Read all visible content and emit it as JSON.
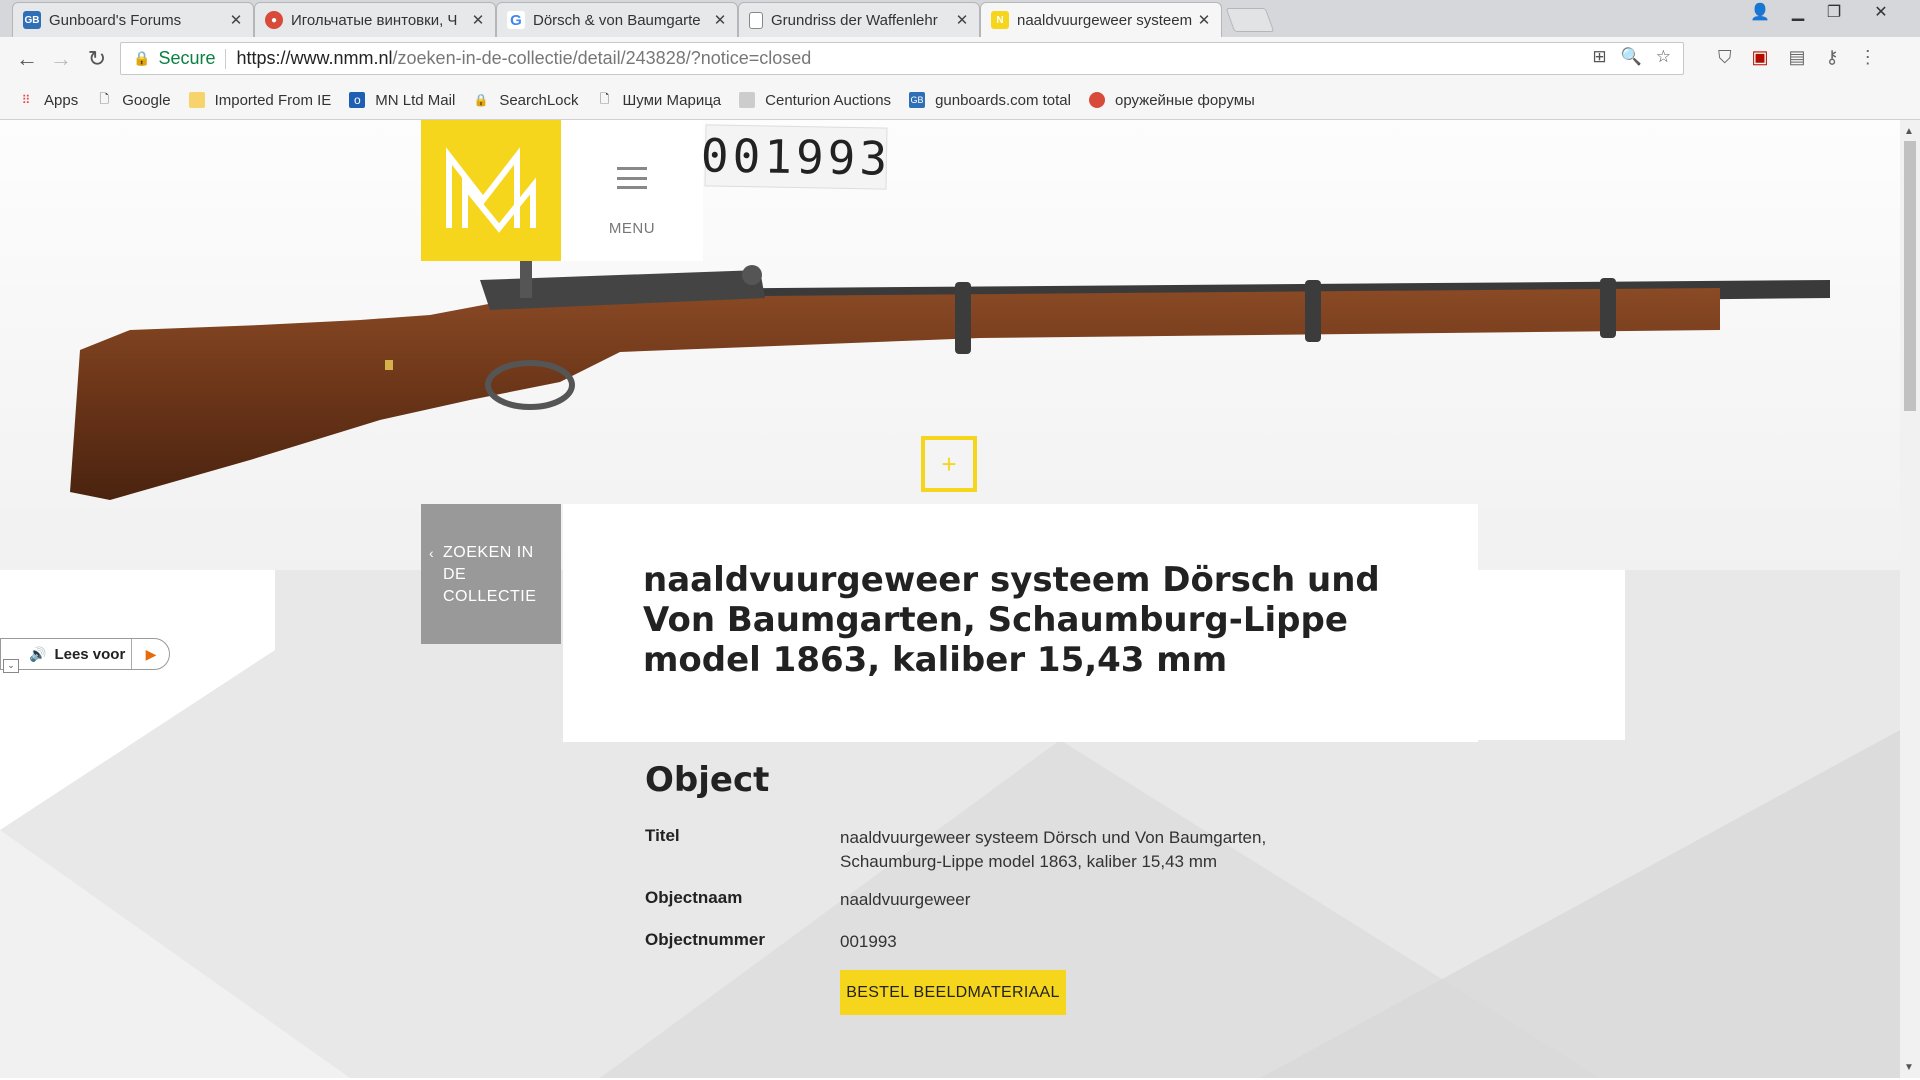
{
  "browser": {
    "tabs": [
      {
        "title": "Gunboard's Forums",
        "favicon": "GB",
        "color": "#2f6fb5"
      },
      {
        "title": "Игольчатые винтовки, Ч",
        "favicon": "R",
        "color": "#d84a3a"
      },
      {
        "title": "Dörsch & von Baumgarte",
        "favicon": "G",
        "color": "#4285f4"
      },
      {
        "title": "Grundriss der Waffenlehr",
        "favicon": "doc",
        "color": "#888888"
      },
      {
        "title": "naaldvuurgeweer systeem",
        "favicon": "NM",
        "color": "#f5d61d"
      }
    ],
    "address": {
      "secure_label": "Secure",
      "url_host": "https://www.nmm.nl",
      "url_path": "/zoeken-in-de-collectie/detail/243828/?notice=closed"
    },
    "bookmarks": [
      {
        "label": "Apps",
        "icon": "apps-grid-icon"
      },
      {
        "label": "Google",
        "icon": "page-icon"
      },
      {
        "label": "Imported From IE",
        "icon": "folder-icon"
      },
      {
        "label": "MN Ltd Mail",
        "icon": "outlook-icon"
      },
      {
        "label": "SearchLock",
        "icon": "lock-icon"
      },
      {
        "label": "Шуми Марица",
        "icon": "page-icon"
      },
      {
        "label": "Centurion Auctions",
        "icon": "site-icon"
      },
      {
        "label": "gunboards.com total",
        "icon": "gb-icon"
      },
      {
        "label": "оружейные форумы",
        "icon": "site-icon"
      }
    ]
  },
  "site": {
    "menu_label": "MENU",
    "object_tag_number": "001993",
    "zoom_symbol": "+",
    "back_link": "ZOEKEN IN DE COLLECTIE",
    "title": "naaldvuurgeweer systeem Dörsch und Von Baumgarten, Schaumburg-Lippe model 1863, kaliber 15,43 mm",
    "object_heading": "Object",
    "fields": {
      "titel_label": "Titel",
      "titel_value": "naaldvuurgeweer systeem Dörsch und Von Baumgarten, Schaumburg-Lippe model 1863, kaliber 15,43 mm",
      "objectnaam_label": "Objectnaam",
      "objectnaam_value": "naaldvuurgeweer",
      "objectnummer_label": "Objectnummer",
      "objectnummer_value": "001993"
    },
    "order_button": "BESTEL BEELDMATERIAAL",
    "read_aloud": "Lees voor",
    "colors": {
      "accent": "#f5d61d",
      "backbox": "#999999"
    }
  }
}
